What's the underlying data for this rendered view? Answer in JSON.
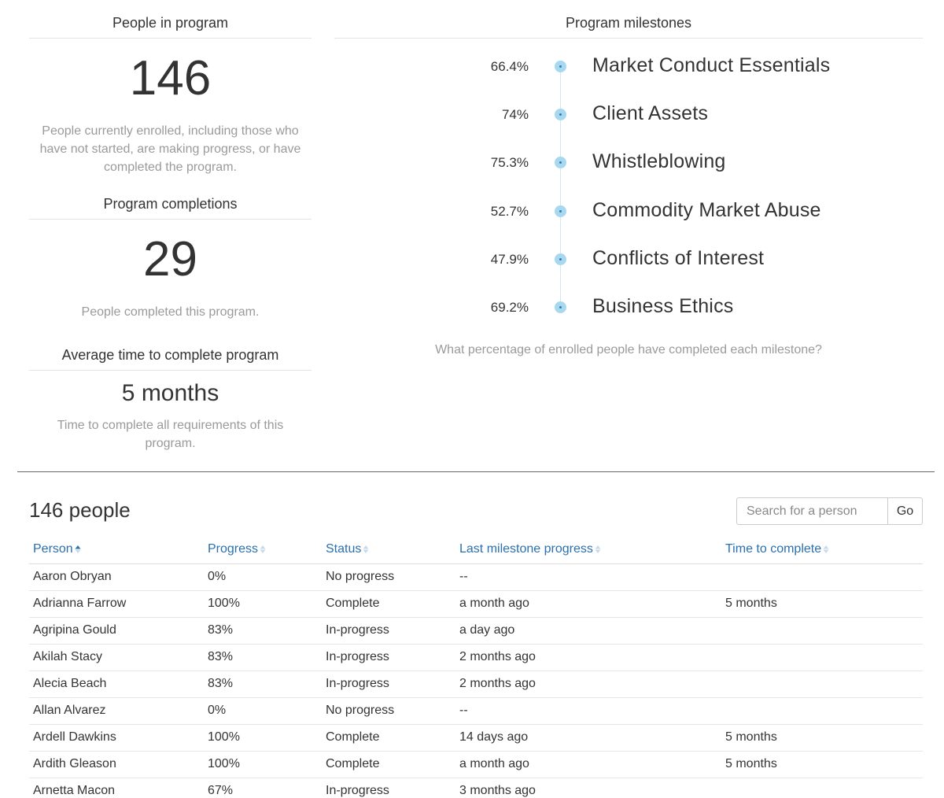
{
  "stats": {
    "enrolled": {
      "title": "People in program",
      "value": "146",
      "description": "People currently enrolled, including those who have not started, are making progress, or have completed the program."
    },
    "completions": {
      "title": "Program completions",
      "value": "29",
      "description": "People completed this program."
    },
    "avg_time": {
      "title": "Average time to complete program",
      "value": "5 months",
      "description": "Time to complete all requirements of this program."
    }
  },
  "milestones": {
    "title": "Program milestones",
    "caption": "What percentage of enrolled people have completed each milestone?",
    "items": [
      {
        "pct": "66.4%",
        "name": "Market Conduct Essentials"
      },
      {
        "pct": "74%",
        "name": "Client Assets"
      },
      {
        "pct": "75.3%",
        "name": "Whistleblowing"
      },
      {
        "pct": "52.7%",
        "name": "Commodity Market Abuse"
      },
      {
        "pct": "47.9%",
        "name": "Conflicts of Interest"
      },
      {
        "pct": "69.2%",
        "name": "Business Ethics"
      }
    ]
  },
  "people": {
    "title": "146 people",
    "search": {
      "placeholder": "Search for a person",
      "go_label": "Go"
    },
    "columns": [
      "Person",
      "Progress",
      "Status",
      "Last milestone progress",
      "Time to complete"
    ],
    "rows": [
      [
        "Aaron Obryan",
        "0%",
        "No progress",
        "--",
        ""
      ],
      [
        "Adrianna Farrow",
        "100%",
        "Complete",
        "a month ago",
        "5 months"
      ],
      [
        "Agripina Gould",
        "83%",
        "In-progress",
        "a day ago",
        ""
      ],
      [
        "Akilah Stacy",
        "83%",
        "In-progress",
        "2 months ago",
        ""
      ],
      [
        "Alecia Beach",
        "83%",
        "In-progress",
        "2 months ago",
        ""
      ],
      [
        "Allan Alvarez",
        "0%",
        "No progress",
        "--",
        ""
      ],
      [
        "Ardell Dawkins",
        "100%",
        "Complete",
        "14 days ago",
        "5 months"
      ],
      [
        "Ardith Gleason",
        "100%",
        "Complete",
        "a month ago",
        "5 months"
      ],
      [
        "Arnetta Macon",
        "67%",
        "In-progress",
        "3 months ago",
        ""
      ]
    ]
  }
}
